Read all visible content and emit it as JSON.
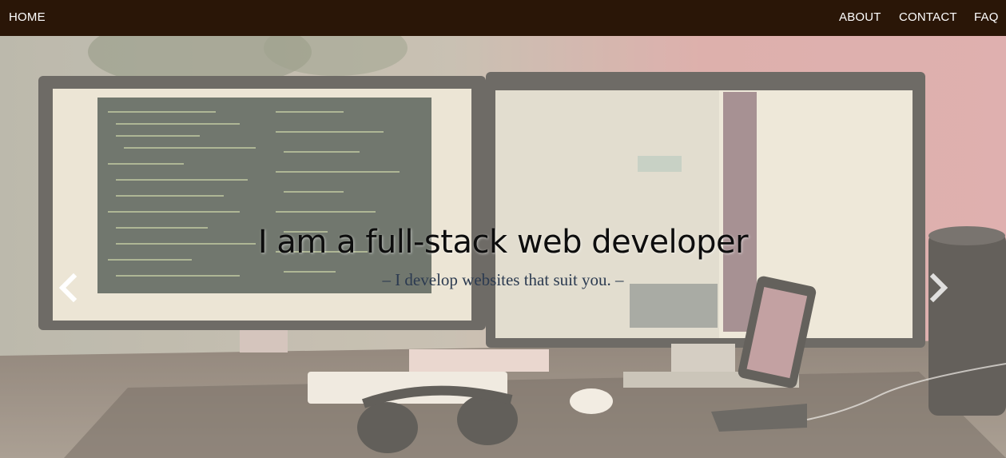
{
  "nav": {
    "home": "HOME",
    "about": "ABOUT",
    "contact": "CONTACT",
    "faq": "FAQ"
  },
  "hero": {
    "title": "I am a full-stack web developer",
    "subtitle": "– I develop websites that suit you. –",
    "background_image": "desk-with-monitors-photo"
  },
  "carousel": {
    "prev_icon": "chevron-left-icon",
    "next_icon": "chevron-right-icon"
  },
  "colors": {
    "navbar": "#2a1607",
    "nav_text": "#ffffff",
    "title_text": "#0d0d0d",
    "subtitle_text": "#2b3a50"
  }
}
